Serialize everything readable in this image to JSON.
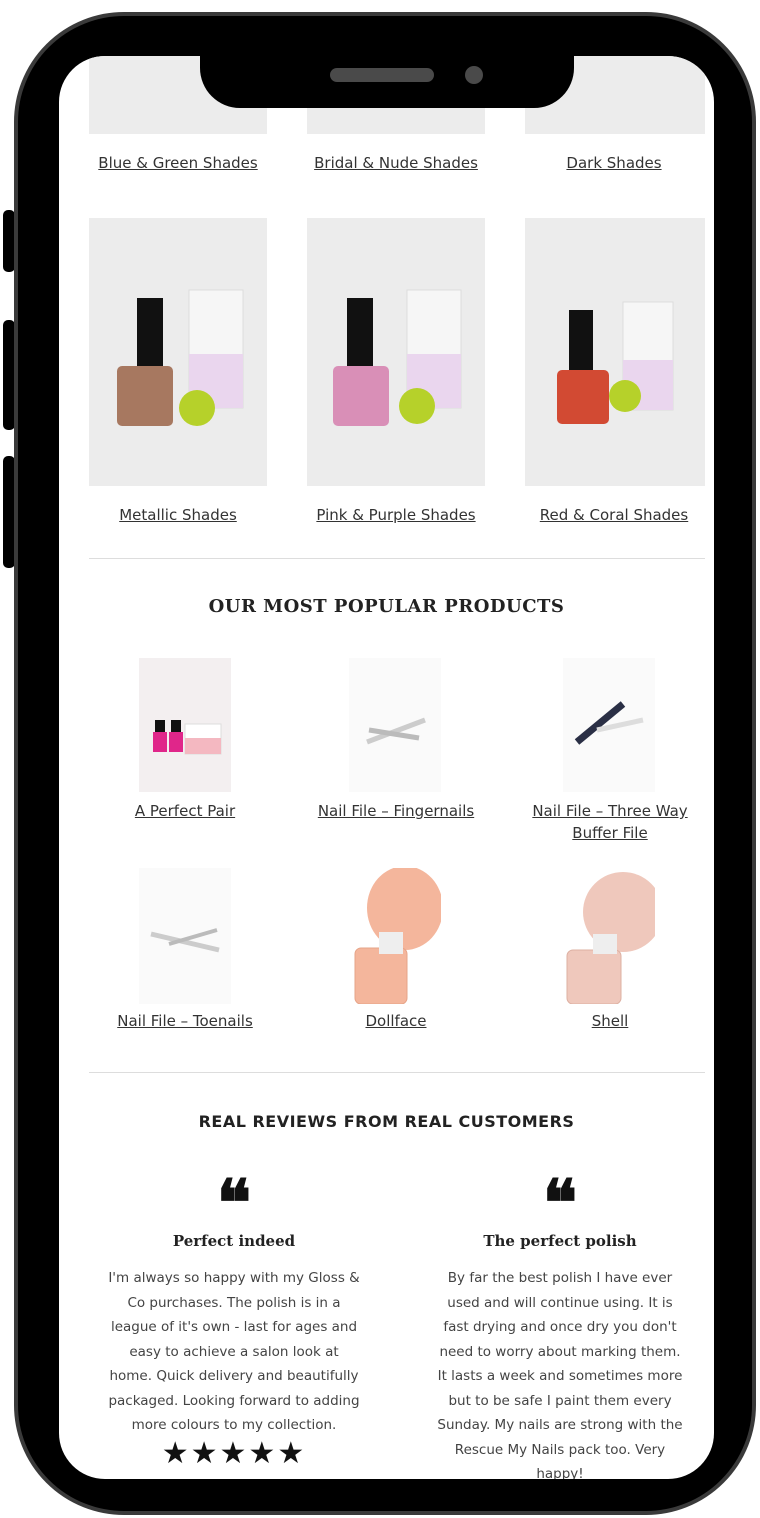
{
  "categories": [
    {
      "label": "Blue & Green Shades"
    },
    {
      "label": "Bridal & Nude Shades"
    },
    {
      "label": "Dark Shades"
    },
    {
      "label": "Metallic Shades",
      "color": "#a77860"
    },
    {
      "label": "Pink & Purple Shades",
      "color": "#d98fb7"
    },
    {
      "label": "Red & Coral Shades",
      "color": "#d24a33"
    }
  ],
  "popular": {
    "title": "OUR MOST POPULAR PRODUCTS",
    "products": [
      {
        "label": "A Perfect Pair"
      },
      {
        "label": "Nail File – Fingernails"
      },
      {
        "label": "Nail File – Three Way"
      },
      {
        "label": "Buffer File"
      },
      {
        "label": "Nail File – Toenails"
      },
      {
        "label": "Dollface",
        "color": "#f4b69c"
      },
      {
        "label": "Shell",
        "color": "#efc8bc"
      }
    ]
  },
  "reviews": {
    "title": "REAL REVIEWS FROM REAL CUSTOMERS",
    "items": [
      {
        "quote_mark": "❝",
        "title": "Perfect indeed",
        "lines": [
          "I'm always so happy with my Gloss &",
          "Co purchases. The polish is in a",
          "league of it's own - last for ages and",
          "easy to achieve a salon look at",
          "home. Quick delivery and beautifully",
          "packaged. Looking forward to adding",
          "more colours to my collection."
        ],
        "stars": "★★★★★"
      },
      {
        "quote_mark": "❝",
        "title": "The perfect polish",
        "lines": [
          "By far the best polish I have ever",
          "used and will continue using. It is",
          "fast drying and once dry you don't",
          "need to worry about marking them.",
          "It lasts a week and sometimes more",
          "but to be safe I paint them every",
          "Sunday. My nails are strong with the",
          "Rescue My Nails pack too. Very",
          "happy!"
        ]
      }
    ]
  }
}
